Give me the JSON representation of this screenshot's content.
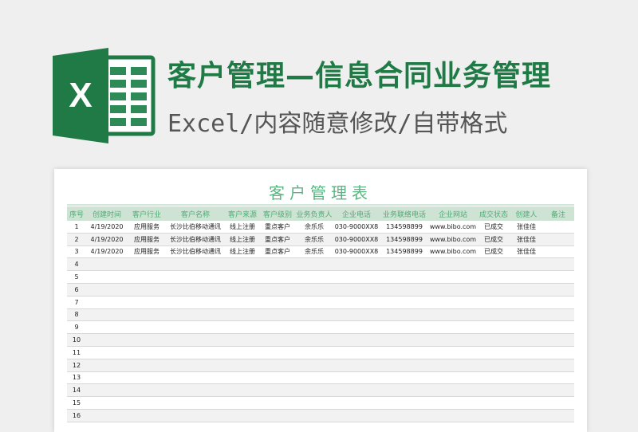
{
  "header": {
    "title": "客户管理—信息合同业务管理",
    "subtitle": "Excel/内容随意修改/自带格式",
    "logo_letter": "X",
    "brand_color": "#1f7a46",
    "logo_icon": "excel-logo-icon"
  },
  "sheet": {
    "title": "客户管理表",
    "columns": [
      "序号",
      "创建时间",
      "客户行业",
      "客户名称",
      "客户来源",
      "客户级别",
      "业务负责人",
      "企业电话",
      "业务联络电话",
      "企业网站",
      "成交状态",
      "创建人",
      "备注"
    ],
    "rows": [
      [
        "1",
        "4/19/2020",
        "应用服务",
        "长沙比伯移动通讯",
        "线上注册",
        "重点客户",
        "余乐乐",
        "030-9000XX8",
        "134598899",
        "www.bibo.com",
        "已成交",
        "张佳佳",
        ""
      ],
      [
        "2",
        "4/19/2020",
        "应用服务",
        "长沙比伯移动通讯",
        "线上注册",
        "重点客户",
        "余乐乐",
        "030-9000XX8",
        "134598899",
        "www.bibo.com",
        "已成交",
        "张佳佳",
        ""
      ],
      [
        "3",
        "4/19/2020",
        "应用服务",
        "长沙比伯移动通讯",
        "线上注册",
        "重点客户",
        "余乐乐",
        "030-9000XX8",
        "134598899",
        "www.bibo.com",
        "已成交",
        "张佳佳",
        ""
      ],
      [
        "4"
      ],
      [
        "5"
      ],
      [
        "6"
      ],
      [
        "7"
      ],
      [
        "8"
      ],
      [
        "9"
      ],
      [
        "10"
      ],
      [
        "11"
      ],
      [
        "12"
      ],
      [
        "13"
      ],
      [
        "14"
      ],
      [
        "15"
      ],
      [
        "16"
      ]
    ]
  }
}
